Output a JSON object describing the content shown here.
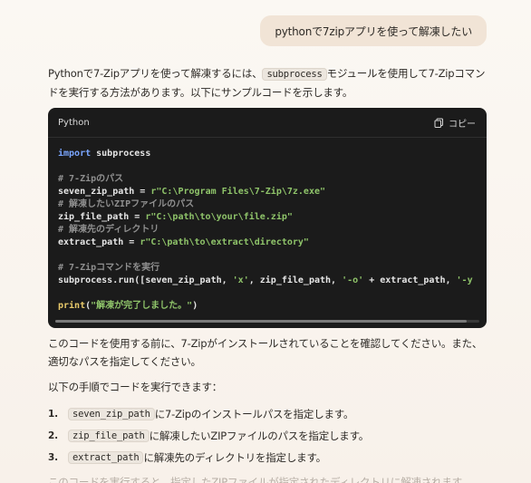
{
  "user_message": "pythonで7zipアプリを使って解凍したい",
  "intro": {
    "part1": "Pythonで7-Zipアプリを使って解凍するには、",
    "code": "subprocess",
    "part2": "モジュールを使用して7-Zipコマンドを実行する方法があります。以下にサンプルコードを示します。"
  },
  "code_block": {
    "language": "Python",
    "copy_label": "コピー",
    "lines": [
      {
        "t": "kw",
        "a": "import",
        "b": " subprocess"
      },
      {
        "t": "blank"
      },
      {
        "t": "cm",
        "a": "# 7-Zipのパス"
      },
      {
        "t": "st",
        "a": "seven_zip_path = ",
        "b": "r\"C:\\Program Files\\7-Zip\\7z.exe\""
      },
      {
        "t": "cm",
        "a": "# 解凍したいZIPファイルのパス"
      },
      {
        "t": "st",
        "a": "zip_file_path = ",
        "b": "r\"C:\\path\\to\\your\\file.zip\""
      },
      {
        "t": "cm",
        "a": "# 解凍先のディレクトリ"
      },
      {
        "t": "st",
        "a": "extract_path = ",
        "b": "r\"C:\\path\\to\\extract\\directory\""
      },
      {
        "t": "blank"
      },
      {
        "t": "cm",
        "a": "# 7-Zipコマンドを実行"
      },
      {
        "t": "run",
        "a": "subprocess.run([seven_zip_path, ",
        "b": "'x'",
        "c": ", zip_file_path, ",
        "d": "'-o'",
        "e": " + extract_path, ",
        "f": "'-y"
      },
      {
        "t": "blank"
      },
      {
        "t": "fn",
        "a": "print",
        "b": "(",
        "c": "\"解凍が完了しました。\"",
        "d": ")"
      }
    ]
  },
  "after_text": "このコードを使用する前に、7-Zipがインストールされていることを確認してください。また、適切なパスを指定してください。",
  "steps_intro": "以下の手順でコードを実行できます：",
  "steps": [
    {
      "num": "1.",
      "code": "seven_zip_path",
      "text": "に7-Zipのインストールパスを指定します。"
    },
    {
      "num": "2.",
      "code": "zip_file_path",
      "text": "に解凍したいZIPファイルのパスを指定します。"
    },
    {
      "num": "3.",
      "code": "extract_path",
      "text": "に解凍先のディレクトリを指定します。"
    }
  ],
  "final_text": "このコードを実行すると、指定したZIPファイルが指定されたディレクトリに解凍されます。",
  "colors": {
    "bubble": "#f1e4d6",
    "code_bg": "#1b1b1b",
    "keyword": "#7aa6ff",
    "string": "#8fc46a",
    "comment": "#8f8f8f",
    "function": "#e8c96a"
  }
}
